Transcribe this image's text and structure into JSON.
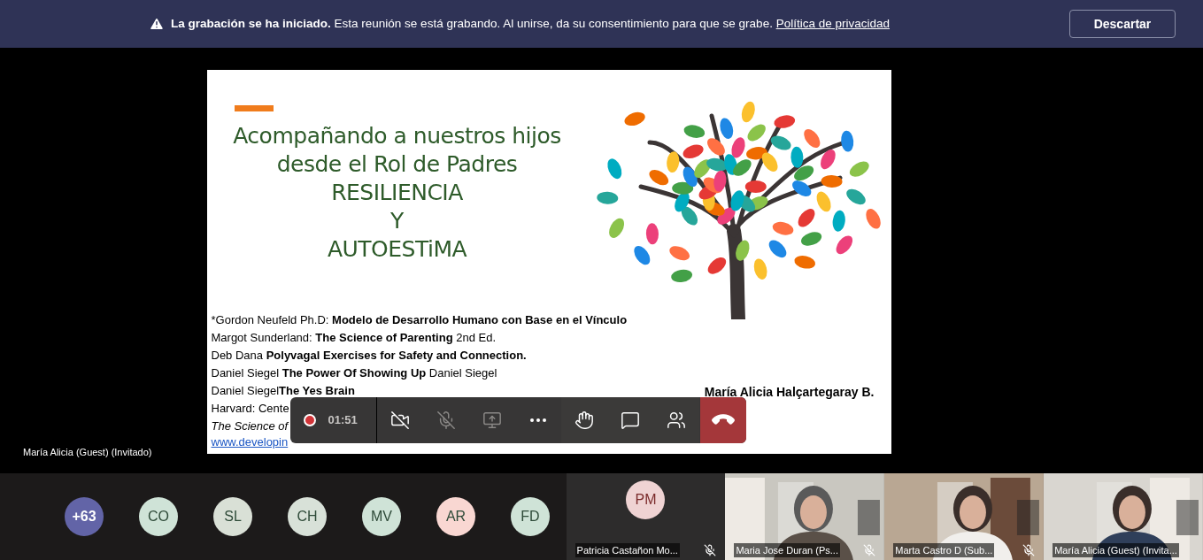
{
  "banner": {
    "message": "**La grabación se ha iniciado.** Esta reunión se está grabando. Al unirse, da su consentimiento para que se grabe.",
    "link": "Política de privacidad",
    "button": "Descartar"
  },
  "slide": {
    "title_lines": [
      "Acompañando a nuestros hijos",
      "desde el Rol de Padres",
      "RESILIENCIA",
      "Y",
      "AUTOESTiMA"
    ],
    "references": [
      {
        "kind": "plain",
        "text": "*Gordon Neufeld Ph.D: **Modelo de Desarrollo Humano con Base en el Vínculo**"
      },
      {
        "kind": "plain",
        "text": "Margot Sunderland: **The Science of Parenting** 2nd Ed."
      },
      {
        "kind": "plain",
        "text": "Deb Dana **Polyvagal Exercises for Safety and Connection.**"
      },
      {
        "kind": "plain",
        "text": "Daniel Siegel **The Power Of Showing Up** Daniel Siegel"
      },
      {
        "kind": "plain",
        "text": "Daniel Siegel**The Yes Brain**"
      },
      {
        "kind": "plain",
        "text": "Harvard: Cente"
      },
      {
        "kind": "italic",
        "text": "The Science of"
      },
      {
        "kind": "link",
        "text": "www.developin"
      }
    ],
    "author": "María Alicia Halçartegaray B."
  },
  "presenter_label": "María Alicia (Guest) (Invitado)",
  "toolbar": {
    "time": "01:51",
    "buttons": [
      {
        "kind": "camera",
        "disabled": false
      },
      {
        "kind": "mic",
        "disabled": true
      },
      {
        "kind": "share",
        "disabled": true
      },
      {
        "kind": "more",
        "disabled": false
      },
      {
        "kind": "hand",
        "disabled": false
      },
      {
        "kind": "chat",
        "disabled": false
      },
      {
        "kind": "people",
        "disabled": false
      },
      {
        "kind": "hangup",
        "disabled": false
      }
    ]
  },
  "avatars": [
    {
      "initials": "+63",
      "color": "#6264a7"
    },
    {
      "initials": "CO",
      "color": "#cfe3d7"
    },
    {
      "initials": "SL",
      "color": "#d9e0d6"
    },
    {
      "initials": "CH",
      "color": "#d8e1d8"
    },
    {
      "initials": "MV",
      "color": "#cfe3d7"
    },
    {
      "initials": "AR",
      "color": "#f9d7d2"
    },
    {
      "initials": "FD",
      "color": "#cfe3d7"
    }
  ],
  "tiles": [
    {
      "kind": "avatar",
      "initials": "PM",
      "name": "Patricia Castañon Mo...",
      "muted": true
    },
    {
      "kind": "video",
      "name": "Maria Jose Duran (Ps...",
      "muted": true
    },
    {
      "kind": "video",
      "name": "Marta Castro D (Sub...",
      "muted": true
    },
    {
      "kind": "video",
      "name": "María Alicia (Guest) (Invita...",
      "muted": false
    }
  ]
}
